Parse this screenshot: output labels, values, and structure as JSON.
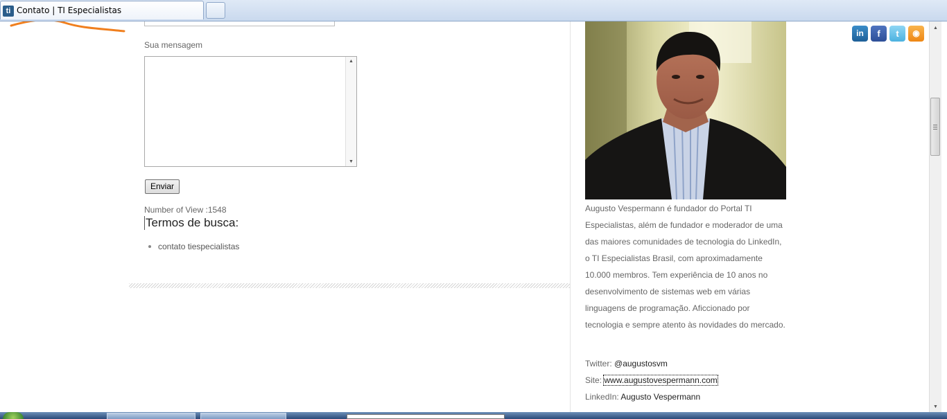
{
  "browser": {
    "tab_title": "Contato | TI Especialistas",
    "favicon_text": "ti"
  },
  "form": {
    "message_label": "Sua mensagem",
    "message_value": "",
    "submit_label": "Enviar",
    "views_text": "Number of View :1548"
  },
  "search_terms": {
    "title": "Termos de busca:",
    "items": [
      "contato tiespecialistas"
    ]
  },
  "author": {
    "bio": "Augusto Vespermann é fundador do Portal TI Especialistas, além de fundador e moderador de uma das maiores comunidades de tecnologia do LinkedIn, o TI Especialistas Brasil, com aproximadamente 10.000 membros. Tem experiência de 10 anos no desenvolvimento de sistemas web em várias linguagens de programação. Aficcionado por tecnologia e sempre atento às novidades do mercado.",
    "twitter_label": "Twitter:",
    "twitter_value": "@augustosvm",
    "site_label": "Site:",
    "site_value": "www.augustovespermann.com",
    "linkedin_label": "LinkedIn:",
    "linkedin_value": "Augusto Vespermann"
  },
  "social": [
    {
      "name": "linkedin",
      "glyph": "in",
      "color": "#1d5f98"
    },
    {
      "name": "facebook",
      "glyph": "f",
      "color": "#2d4f98"
    },
    {
      "name": "twitter",
      "glyph": "t",
      "color": "#4cb2e0"
    },
    {
      "name": "rss",
      "glyph": "◉",
      "color": "#ee8613"
    }
  ],
  "colors": {
    "accent_swoosh": "#f07f1e",
    "text_muted": "#666666"
  }
}
